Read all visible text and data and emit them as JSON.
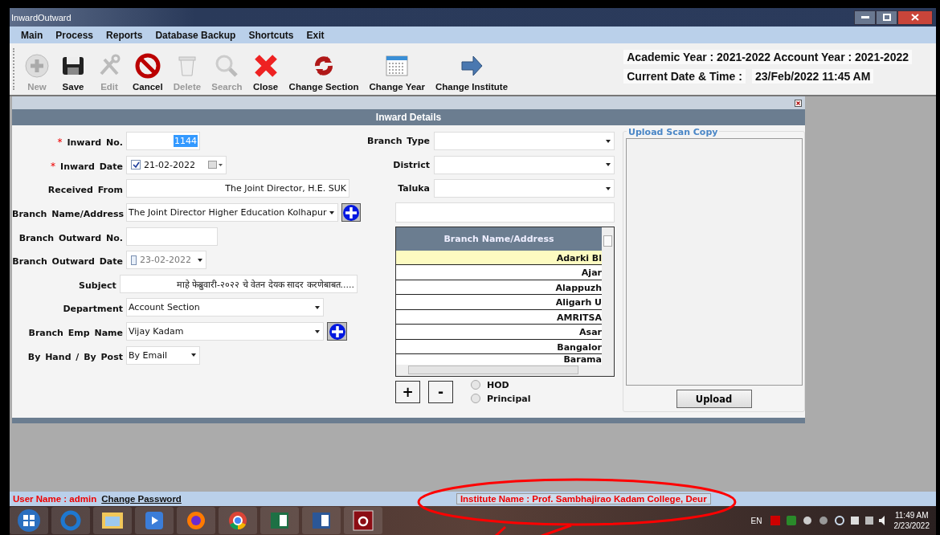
{
  "window": {
    "title": "InwardOutward"
  },
  "menu": [
    "Main",
    "Process",
    "Reports",
    "Database Backup",
    "Shortcuts",
    "Exit"
  ],
  "toolbar": [
    {
      "label": "New",
      "disabled": true
    },
    {
      "label": "Save",
      "disabled": false
    },
    {
      "label": "Edit",
      "disabled": true
    },
    {
      "label": "Cancel",
      "disabled": false
    },
    {
      "label": "Delete",
      "disabled": true
    },
    {
      "label": "Search",
      "disabled": true
    },
    {
      "label": "Close",
      "disabled": false
    },
    {
      "label": "Change Section",
      "disabled": false
    },
    {
      "label": "Change Year",
      "disabled": false
    },
    {
      "label": "Change Institute",
      "disabled": false
    }
  ],
  "info": {
    "years": "Academic Year : 2021-2022 Account Year : 2021-2022",
    "date_label": "Current Date & Time :",
    "date_value": "23/Feb/2022 11:45 AM"
  },
  "panel": {
    "title": "Inward Details",
    "left_fields": [
      {
        "label": "Inward No.",
        "required_mark": "*",
        "kind": "text",
        "value": "1144",
        "text_selected": true
      },
      {
        "label": "Inward Date",
        "required_mark": "*",
        "kind": "date",
        "value": "21-02-2022",
        "checked": true
      },
      {
        "label": "Received From",
        "kind": "text",
        "value": "The Joint Director, H.E. SUK",
        "text_selected": false
      },
      {
        "label": "Branch Name/Address",
        "kind": "combo",
        "value": "The Joint Director Higher Education Kolhapur",
        "add_button": true
      },
      {
        "label": "Branch Outward No.",
        "kind": "text"
      },
      {
        "label": "Branch Outward Date",
        "kind": "date",
        "value": "23-02-2022",
        "checked": false
      },
      {
        "label": "Subject",
        "kind": "text",
        "value": "माहे फेब्रुवारी-२०२२ चे वेतन देयक सादर करणेबाबत.....",
        "text_selected": false
      },
      {
        "label": "Department",
        "kind": "combo",
        "value": "Account Section",
        "add_button": false
      },
      {
        "label": "Branch Emp Name",
        "kind": "combo",
        "value": "Vijay Kadam",
        "add_button": true
      },
      {
        "label": "By Hand / By Post",
        "kind": "combo",
        "value": "By Email",
        "add_button": false
      }
    ],
    "mid_fields": [
      {
        "label": "Branch Type"
      },
      {
        "label": "District"
      },
      {
        "label": "Taluka"
      }
    ],
    "grid": {
      "column": "Branch Name/Address",
      "rows": [
        {
          "text": "Adarki Bl",
          "selected": true
        },
        {
          "text": "Ajar",
          "selected": false
        },
        {
          "text": "Alappuzh",
          "selected": false
        },
        {
          "text": "Aligarh U",
          "selected": false
        },
        {
          "text": "AMRITSA",
          "selected": false
        },
        {
          "text": "Asar",
          "selected": false
        },
        {
          "text": "Bangalor",
          "selected": false
        },
        {
          "text": "Barama",
          "selected": false
        }
      ]
    },
    "grid_buttons": [
      "+",
      "-"
    ],
    "radios": [
      {
        "label": "HOD",
        "selected": false
      },
      {
        "label": "Principal",
        "selected": false
      }
    ],
    "upload": {
      "legend": "Upload Scan Copy",
      "button": "Upload"
    }
  },
  "status_bar": {
    "user": "User Name : admin",
    "link": "Change Password",
    "institute": "Institute Name : Prof. Sambhajirao Kadam College, Deur"
  },
  "taskbar": {
    "language": "EN",
    "time": "11:49 AM",
    "date": "2/23/2022"
  }
}
